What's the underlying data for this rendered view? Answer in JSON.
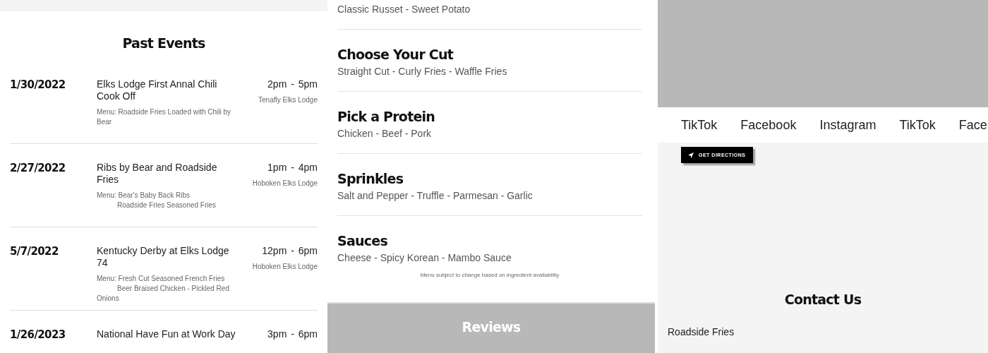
{
  "past_events": {
    "title": "Past Events",
    "events": [
      {
        "date": "1/30/2022",
        "name": "Elks Lodge First Annal Chili Cook Off",
        "menu": [
          "Menu: Roadside Fries Loaded with Chili by Bear"
        ],
        "time": "2pm - 5pm",
        "location": "Tenafly Elks Lodge"
      },
      {
        "date": "2/27/2022",
        "name": "Ribs by Bear and Roadside Fries",
        "menu": [
          "Menu: Bear's Baby Back Ribs",
          "Roadside Fries Seasoned Fries"
        ],
        "time": "1pm - 4pm",
        "location": "Hoboken Elks Lodge"
      },
      {
        "date": "5/7/2022",
        "name": "Kentucky Derby at Elks Lodge 74",
        "menu": [
          "Menu: Fresh Cut Seasoned French Fries",
          "Beer Braised Chicken - Pickled Red Onions"
        ],
        "time": "12pm - 6pm",
        "location": "Hoboken Elks Lodge"
      },
      {
        "date": "1/26/2023",
        "name": "National Have Fun at Work Day",
        "time": "3pm - 6pm"
      }
    ]
  },
  "menu": {
    "sections": [
      {
        "options": "Classic Russet - Sweet Potato"
      },
      {
        "heading": "Choose Your Cut",
        "options": "Straight Cut - Curly Fries - Waffle Fries"
      },
      {
        "heading": "Pick a Protein",
        "options": "Chicken - Beef - Pork"
      },
      {
        "heading": "Sprinkles",
        "options": "Salt and Pepper - Truffle - Parmesan - Garlic"
      },
      {
        "heading": "Sauces",
        "options": "Cheese - Spicy Korean - Mambo Sauce"
      }
    ],
    "note": "Menu subject to change based on ingredient availability"
  },
  "reviews": {
    "title": "Reviews"
  },
  "social_links": [
    "TikTok",
    "Facebook",
    "Instagram",
    "TikTok",
    "Face"
  ],
  "directions_button": "GET DIRECTIONS",
  "contact": {
    "title": "Contact Us",
    "name": "Roadside Fries"
  }
}
